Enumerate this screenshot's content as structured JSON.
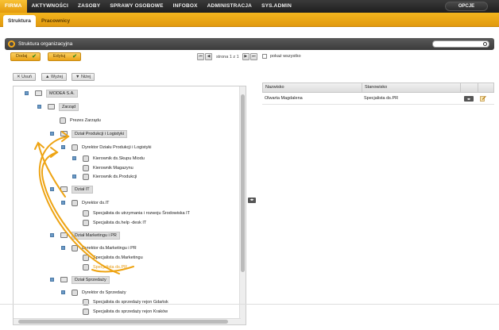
{
  "nav": {
    "items": [
      "FIRMA",
      "AKTYWNOŚCI",
      "ZASOBY",
      "SPRAWY OSOBOWE",
      "INFOBOX",
      "ADMINISTRACJA",
      "SYS.ADMIN"
    ],
    "active": "FIRMA",
    "opcje": "OPCJE"
  },
  "subtabs": [
    "Struktura",
    "Pracownicy"
  ],
  "panel": {
    "title": "Struktura organizacyjna",
    "search_placeholder": ""
  },
  "actions": {
    "add": "Dodaj",
    "edit": "Edytuj"
  },
  "pager": {
    "text": "strona 1 z 1",
    "show_all": "pokaż wszystko"
  },
  "tools": {
    "delete": "Usuń",
    "up": "Wyżej",
    "down": "Niżej"
  },
  "tree": [
    {
      "label": "MODEA S.A.",
      "kind": "unit",
      "expander": true
    },
    {
      "label": "Zarząd",
      "kind": "unit",
      "expander": true
    },
    {
      "label": "Prezes Zarządu",
      "kind": "person",
      "expander": false
    },
    {
      "label": "Dział Produkcji i Logistyki",
      "kind": "unit",
      "expander": true
    },
    {
      "label": "Dyrektor Działu Produkcji i Logistyki",
      "kind": "person",
      "expander": true
    },
    {
      "label": "Kierownik ds.Skupu Miodu",
      "kind": "person",
      "expander": true
    },
    {
      "label": "Kierownik Magazynu",
      "kind": "person",
      "expander": false
    },
    {
      "label": "Kierownik ds.Produkcji",
      "kind": "person",
      "expander": true
    },
    {
      "label": "Dział IT",
      "kind": "unit",
      "expander": true
    },
    {
      "label": "Dyrektor ds.IT",
      "kind": "person",
      "expander": true
    },
    {
      "label": "Specjalista ds utrzymania i rozwoju Środowiska IT",
      "kind": "person",
      "expander": false
    },
    {
      "label": "Specjalista ds.help -desk IT",
      "kind": "person",
      "expander": false
    },
    {
      "label": "Dział Marketingu i PR",
      "kind": "unit",
      "expander": true
    },
    {
      "label": "Dyrektor ds.Marketingu i PR",
      "kind": "person",
      "expander": true
    },
    {
      "label": "Specjalista ds.Marketingu",
      "kind": "person",
      "expander": false
    },
    {
      "label": "Specjalista ds.PR",
      "kind": "person",
      "expander": false,
      "highlight": true
    },
    {
      "label": "Dział Sprzedaży",
      "kind": "unit",
      "expander": true
    },
    {
      "label": "Dyrektor ds Sprzedaży",
      "kind": "person",
      "expander": true
    },
    {
      "label": "Specjalista ds sprzedaży rejon Gdańsk",
      "kind": "person",
      "expander": false
    },
    {
      "label": "Specjalista ds sprzedaży rejon Kraków",
      "kind": "person",
      "expander": false
    }
  ],
  "grid": {
    "headers": [
      "Nazwisko",
      "Stanowisko"
    ],
    "rows": [
      {
        "name": "Olwarta Magdalena",
        "position": "Specjalista ds.PR"
      }
    ]
  },
  "colors": {
    "accent": "#eea414",
    "nav": "#2a2a2a",
    "annotation": "#eea414"
  }
}
